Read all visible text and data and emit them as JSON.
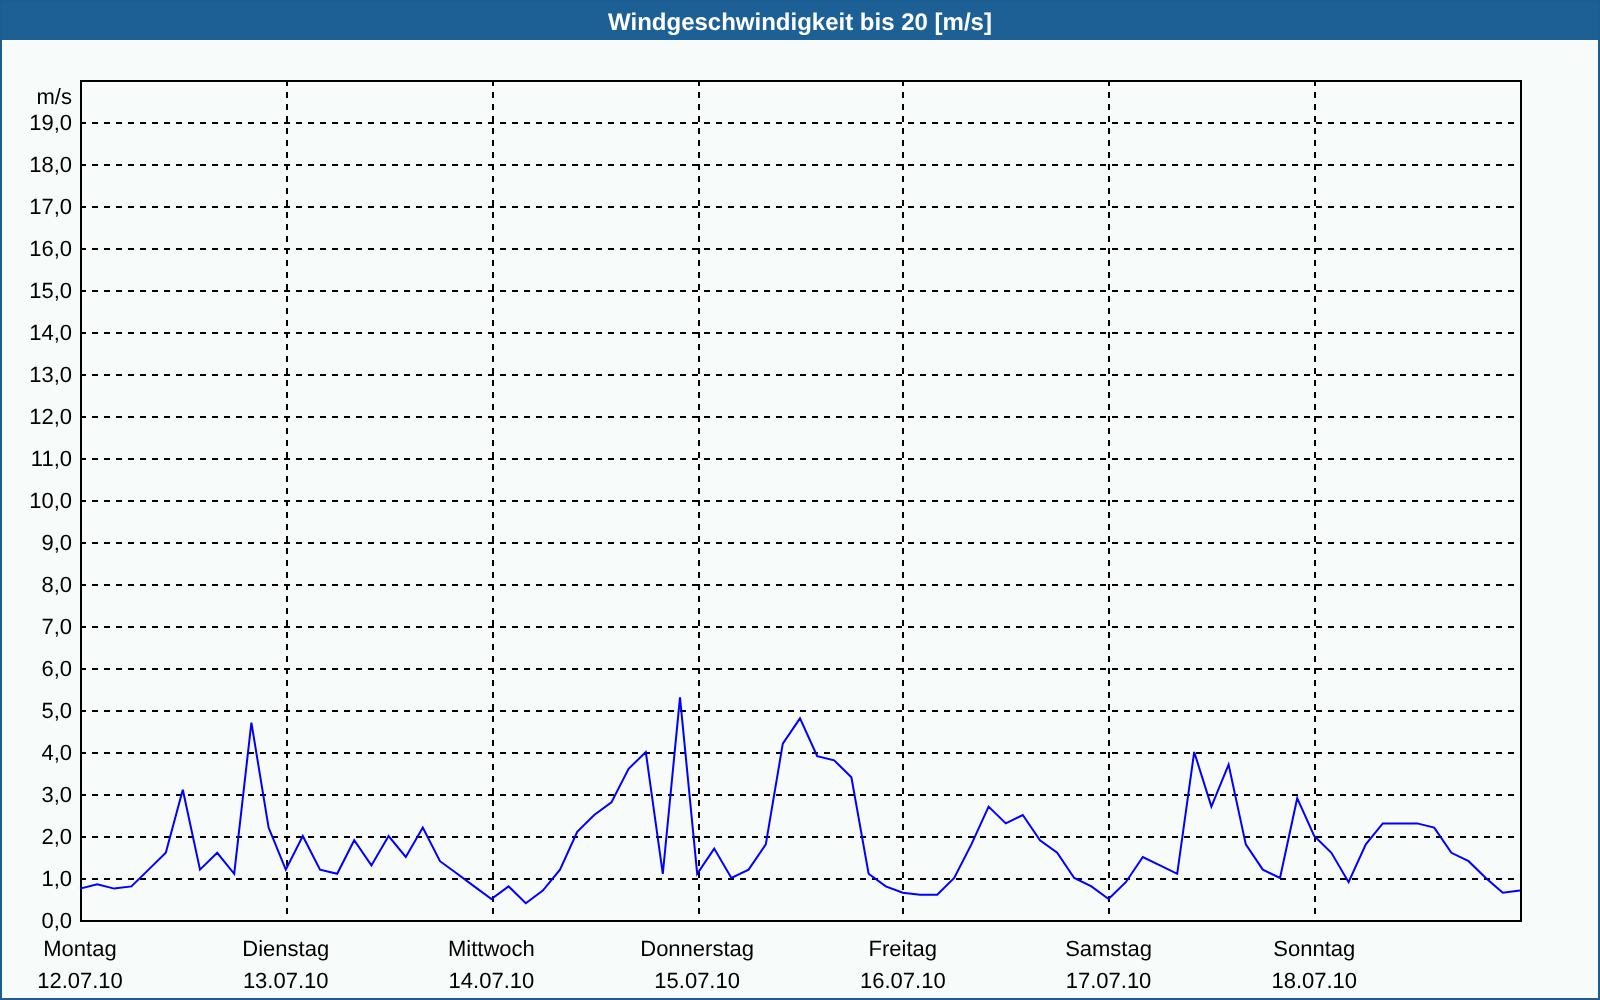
{
  "window": {
    "title": "Windgeschwindigkeit bis 20 [m/s]"
  },
  "chart": {
    "chart_data": {
      "type": "line",
      "grid": true,
      "ylabel": "m/s",
      "ylim": [
        0,
        20
      ],
      "categories": [
        "Montag\n12.07.10",
        null,
        null,
        null,
        null,
        null,
        null,
        null,
        null,
        null,
        null,
        null,
        "Dienstag\n13.07.10",
        null,
        null,
        null,
        null,
        null,
        null,
        null,
        null,
        null,
        null,
        null,
        "Mittwoch\n14.07.10",
        null,
        null,
        null,
        null,
        null,
        null,
        null,
        null,
        null,
        null,
        null,
        "Donnerstag\n15.07.10",
        null,
        null,
        null,
        null,
        null,
        null,
        null,
        null,
        null,
        null,
        null,
        "Freitag\n16.07.10",
        null,
        null,
        null,
        null,
        null,
        null,
        null,
        null,
        null,
        null,
        null,
        "Samstag\n17.07.10",
        null,
        null,
        null,
        null,
        null,
        null,
        null,
        null,
        null,
        null,
        null,
        "Sonntag\n18.07.10",
        null,
        null,
        null,
        null,
        null,
        null,
        null,
        null,
        null,
        null,
        null,
        null
      ],
      "values": [
        0.75,
        0.85,
        0.75,
        0.8,
        1.2,
        1.6,
        3.1,
        1.2,
        1.6,
        1.1,
        4.7,
        2.2,
        1.2,
        2.0,
        1.2,
        1.1,
        1.9,
        1.3,
        2.0,
        1.5,
        2.2,
        1.4,
        1.1,
        0.8,
        0.5,
        0.8,
        0.4,
        0.7,
        1.2,
        2.1,
        2.5,
        2.8,
        3.6,
        4.0,
        1.1,
        5.3,
        1.1,
        1.7,
        1.0,
        1.2,
        1.8,
        4.2,
        4.8,
        3.9,
        3.8,
        3.4,
        1.1,
        0.8,
        0.65,
        0.6,
        0.6,
        1.0,
        1.8,
        2.7,
        2.3,
        2.5,
        1.9,
        1.6,
        1.0,
        0.8,
        0.5,
        0.9,
        1.5,
        1.3,
        1.1,
        4.0,
        2.7,
        3.7,
        1.8,
        1.2,
        1.0,
        2.9,
        2.0,
        1.6,
        0.9,
        1.8,
        2.3,
        2.3,
        2.3,
        2.2,
        1.6,
        1.4,
        1.0,
        0.65,
        0.7
      ],
      "yticks": [
        {
          "value": 0,
          "label": "0,0"
        },
        {
          "value": 1,
          "label": "1,0"
        },
        {
          "value": 2,
          "label": "2,0"
        },
        {
          "value": 3,
          "label": "3,0"
        },
        {
          "value": 4,
          "label": "4,0"
        },
        {
          "value": 5,
          "label": "5,0"
        },
        {
          "value": 6,
          "label": "6,0"
        },
        {
          "value": 7,
          "label": "7,0"
        },
        {
          "value": 8,
          "label": "8,0"
        },
        {
          "value": 9,
          "label": "9,0"
        },
        {
          "value": 10,
          "label": "10,0"
        },
        {
          "value": 11,
          "label": "11,0"
        },
        {
          "value": 12,
          "label": "12,0"
        },
        {
          "value": 13,
          "label": "13,0"
        },
        {
          "value": 14,
          "label": "14,0"
        },
        {
          "value": 15,
          "label": "15,0"
        },
        {
          "value": 16,
          "label": "16,0"
        },
        {
          "value": 17,
          "label": "17,0"
        },
        {
          "value": 18,
          "label": "18,0"
        },
        {
          "value": 19,
          "label": "19,0"
        }
      ]
    }
  }
}
